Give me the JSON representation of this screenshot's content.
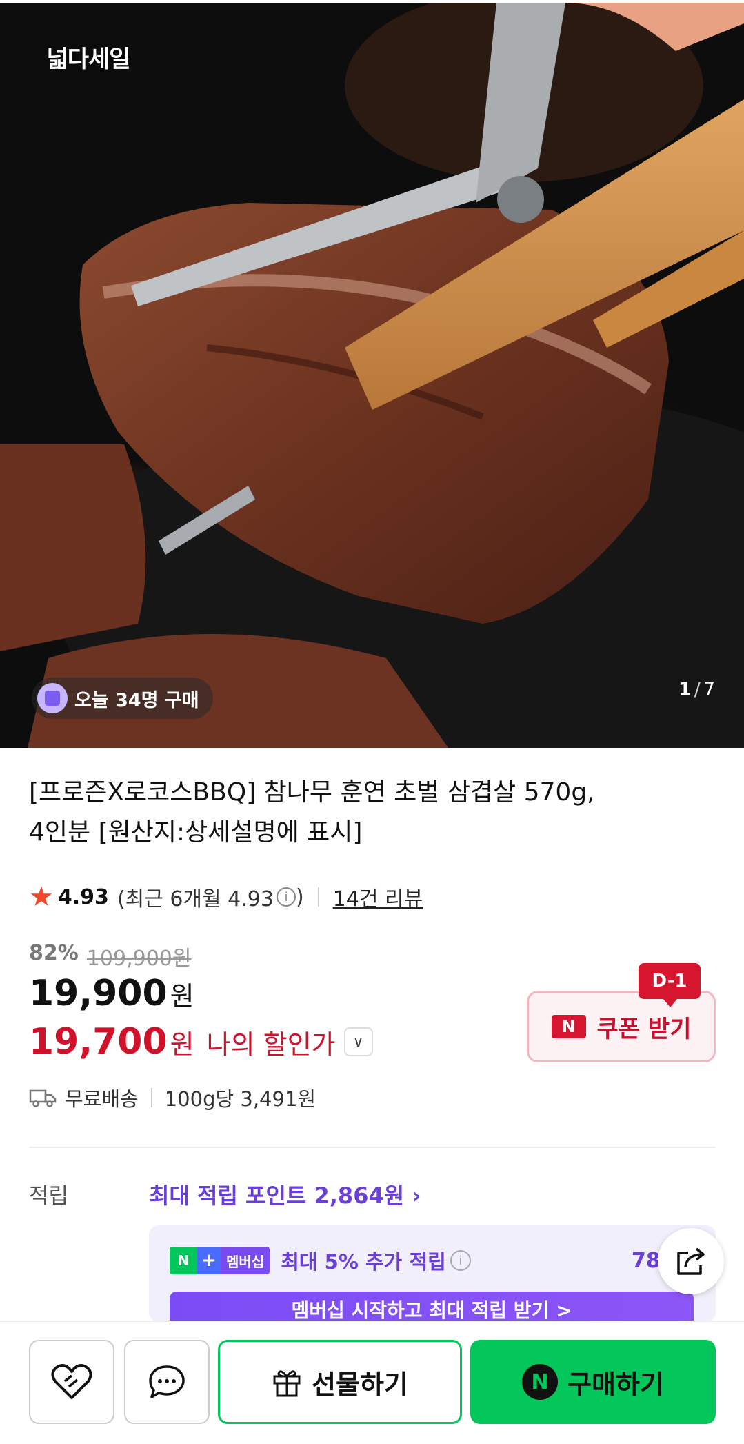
{
  "hero": {
    "brand_badge": "넓다세일",
    "today_buyers": "오늘 34명 구매",
    "image_index": "1",
    "image_total": "7"
  },
  "product": {
    "title_line1": "[프로즌X로코스BBQ] 참나무 훈연 초벌 삼겹살 570g,",
    "title_line2": "4인분 [원산지:상세설명에 표시]",
    "rating": "4.93",
    "rating_recent": "(최근 6개월 4.93",
    "rating_close": ")",
    "review_count": "14건 리뷰",
    "discount_pct": "82%",
    "original_price": "109,900원",
    "price": "19,900",
    "price_unit": "원",
    "my_price": "19,700",
    "my_price_unit": "원",
    "my_price_label": "나의 할인가",
    "shipping": "무료배송",
    "unit_price": "100g당 3,491원"
  },
  "coupon": {
    "badge": "D-1",
    "n_logo": "N",
    "label": "쿠폰 받기"
  },
  "reward": {
    "label": "적립",
    "link": "최대 적립 포인트 2,864원",
    "membership_badge_n": "N",
    "membership_badge_plus": "+",
    "membership_badge_text": "멤버십",
    "membership_text": "최대 5% 추가 적립",
    "membership_amount": "78",
    "membership_button": "멤버십 시작하고 최대 적립 받기 >"
  },
  "bottom": {
    "gift": "선물하기",
    "buy": "구매하기",
    "buy_logo": "N"
  },
  "colors": {
    "naver_green": "#03c75a",
    "discount_red": "#d0112a",
    "purple": "#6a3fd8"
  }
}
